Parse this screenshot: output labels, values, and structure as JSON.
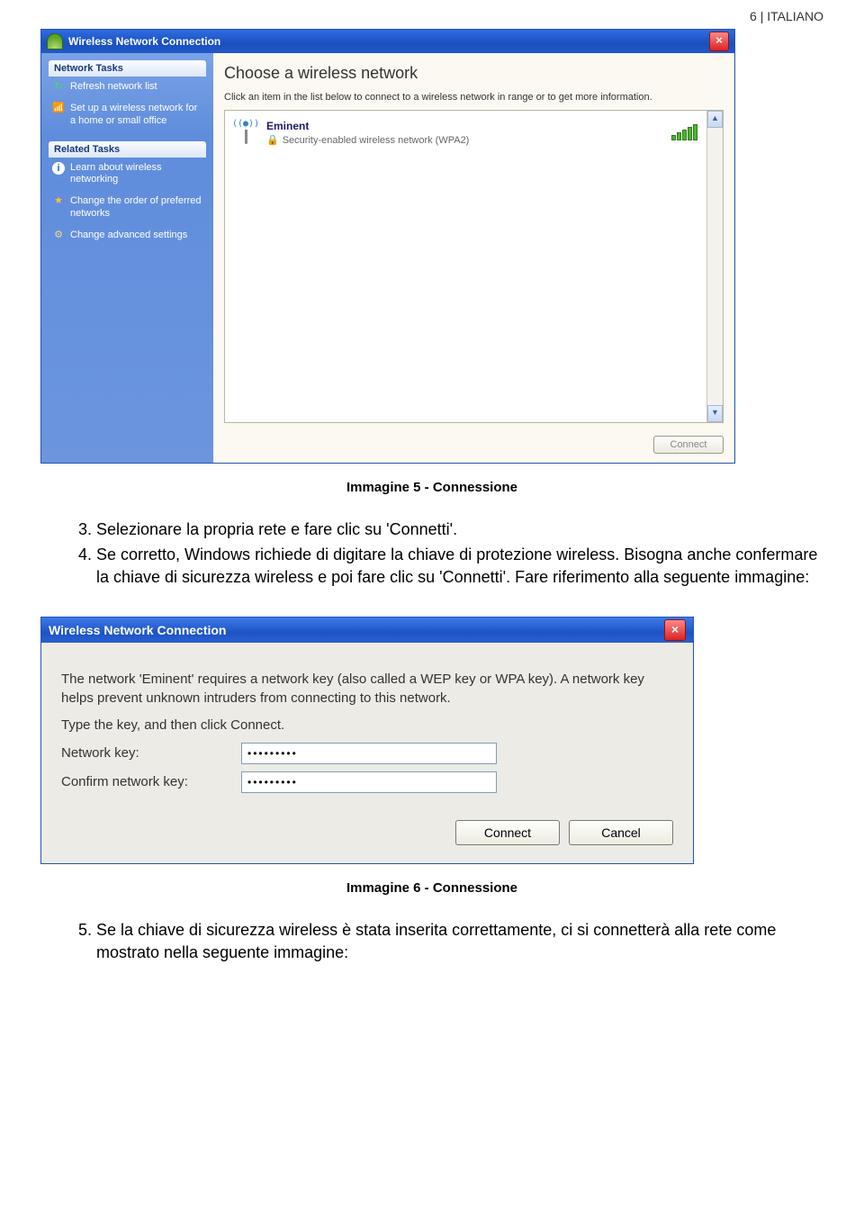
{
  "page_header": "6 | ITALIANO",
  "shot1": {
    "title": "Wireless Network Connection",
    "sidebar": {
      "heading1": "Network Tasks",
      "refresh": "Refresh network list",
      "setup": "Set up a wireless network for a home or small office",
      "heading2": "Related Tasks",
      "learn": "Learn about wireless networking",
      "order": "Change the order of preferred networks",
      "advanced": "Change advanced settings"
    },
    "main": {
      "heading": "Choose a wireless network",
      "desc": "Click an item in the list below to connect to a wireless network in range or to get more information.",
      "network_name": "Eminent",
      "network_sub": "Security-enabled wireless network (WPA2)",
      "connect_btn": "Connect"
    }
  },
  "caption1": "Immagine 5 - Connessione",
  "step3": "Selezionare la propria rete e fare clic su 'Connetti'.",
  "step4": "Se corretto, Windows richiede di digitare la chiave di protezione wireless. Bisogna anche confermare la chiave di sicurezza wireless e poi fare clic su 'Connetti'. Fare riferimento alla seguente immagine:",
  "shot2": {
    "title": "Wireless Network Connection",
    "line1": "The network 'Eminent' requires a network key (also called a WEP key or WPA key). A network key helps prevent unknown intruders from connecting to this network.",
    "line2": "Type the key, and then click Connect.",
    "label_key": "Network key:",
    "label_confirm": "Confirm network key:",
    "masked_value": "•••••••••",
    "connect": "Connect",
    "cancel": "Cancel"
  },
  "caption2": "Immagine 6 - Connessione",
  "step5": "Se la chiave di sicurezza wireless è stata inserita correttamente, ci si connetterà alla rete come mostrato nella seguente immagine:"
}
